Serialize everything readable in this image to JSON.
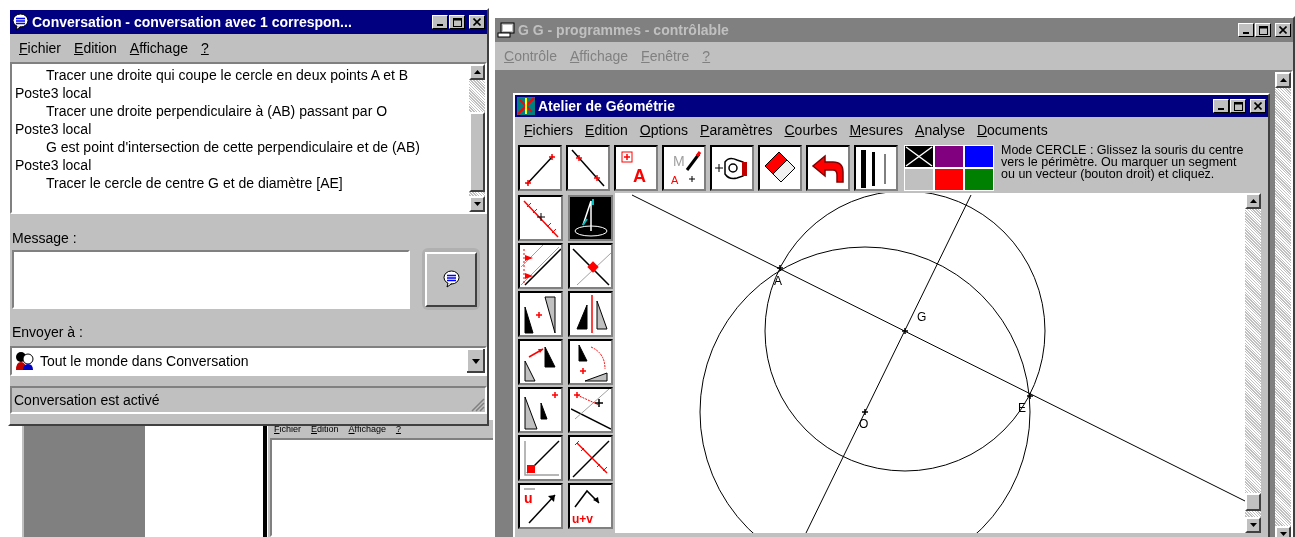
{
  "conversation_window": {
    "title": "Conversation - conversation avec 1 correspon...",
    "active": true,
    "menu": {
      "disabled": false,
      "items": [
        "Fichier",
        "Edition",
        "Affichage",
        "?"
      ]
    },
    "chat": [
      {
        "kind": "message",
        "text": "Tracer une droite qui coupe le cercle en deux points A et B"
      },
      {
        "kind": "sender",
        "text": "Poste3 local"
      },
      {
        "kind": "message",
        "text": "Tracer une droite perpendiculaire à (AB) passant par O"
      },
      {
        "kind": "sender",
        "text": "Poste3 local"
      },
      {
        "kind": "message",
        "text": "G est point d'intersection de cette perpendiculaire et de (AB)"
      },
      {
        "kind": "sender",
        "text": "Poste3 local"
      },
      {
        "kind": "message",
        "text": "Tracer le cercle de centre G et de diamètre [AE]"
      }
    ],
    "message_label": "Message :",
    "send_to_label": "Envoyer à :",
    "send_to": "Tout le monde dans Conversation",
    "status": "Conversation est activé"
  },
  "background_window": {
    "menu": {
      "disabled": false,
      "items": [
        "Fichier",
        "Edition",
        "Affichage",
        "?"
      ]
    }
  },
  "gg_window": {
    "title": "G G - programmes - contrôlable",
    "active": false,
    "menu": {
      "disabled": true,
      "items": [
        "Contrôle",
        "Affichage",
        "Fenêtre",
        "?"
      ]
    }
  },
  "atelier_window": {
    "title": "Atelier de Géométrie",
    "active": true,
    "menu": {
      "disabled": false,
      "items": [
        "Fichiers",
        "Edition",
        "Options",
        "Paramètres",
        "Courbes",
        "Mesures",
        "Analyse",
        "Documents"
      ]
    },
    "toolbar": [
      {
        "kind": "segment"
      },
      {
        "kind": "line"
      },
      {
        "kind": "point-label",
        "labels": [
          "A"
        ]
      },
      {
        "kind": "naming",
        "labels": [
          "M",
          "A"
        ]
      },
      {
        "kind": "camera"
      },
      {
        "kind": "eraser"
      },
      {
        "kind": "undo"
      },
      {
        "kind": "bars"
      }
    ],
    "colors": [
      {
        "color": "#000000",
        "crossed": true
      },
      {
        "color": "#800080",
        "crossed": false
      },
      {
        "color": "#0000ff",
        "crossed": false
      },
      {
        "color": "#c0c0c0",
        "crossed": false
      },
      {
        "color": "#ff0000",
        "crossed": false
      },
      {
        "color": "#008000",
        "crossed": false
      }
    ],
    "hint": "Mode CERCLE : Glissez la souris du centre vers le périmètre. Ou marquer un segment ou un vecteur (bouton droit) et cliquez.",
    "palette": [
      {
        "kind": "ruler",
        "selected": false
      },
      {
        "kind": "compass",
        "selected": true
      },
      {
        "kind": "parallel",
        "selected": false
      },
      {
        "kind": "perpendicular",
        "selected": false
      },
      {
        "kind": "central-symmetry",
        "selected": false
      },
      {
        "kind": "axial-symmetry",
        "selected": false
      },
      {
        "kind": "translation",
        "selected": false
      },
      {
        "kind": "rotation",
        "selected": false
      },
      {
        "kind": "homothety",
        "selected": false
      },
      {
        "kind": "distance",
        "selected": false
      },
      {
        "kind": "right-angle",
        "selected": false
      },
      {
        "kind": "bisector",
        "selected": false
      },
      {
        "kind": "vector",
        "selected": false,
        "labels": [
          "u"
        ]
      },
      {
        "kind": "vector-sum",
        "selected": false,
        "labels": [
          "u+v"
        ]
      }
    ],
    "figure": {
      "points": [
        "A",
        "G",
        "E",
        "O"
      ]
    }
  }
}
